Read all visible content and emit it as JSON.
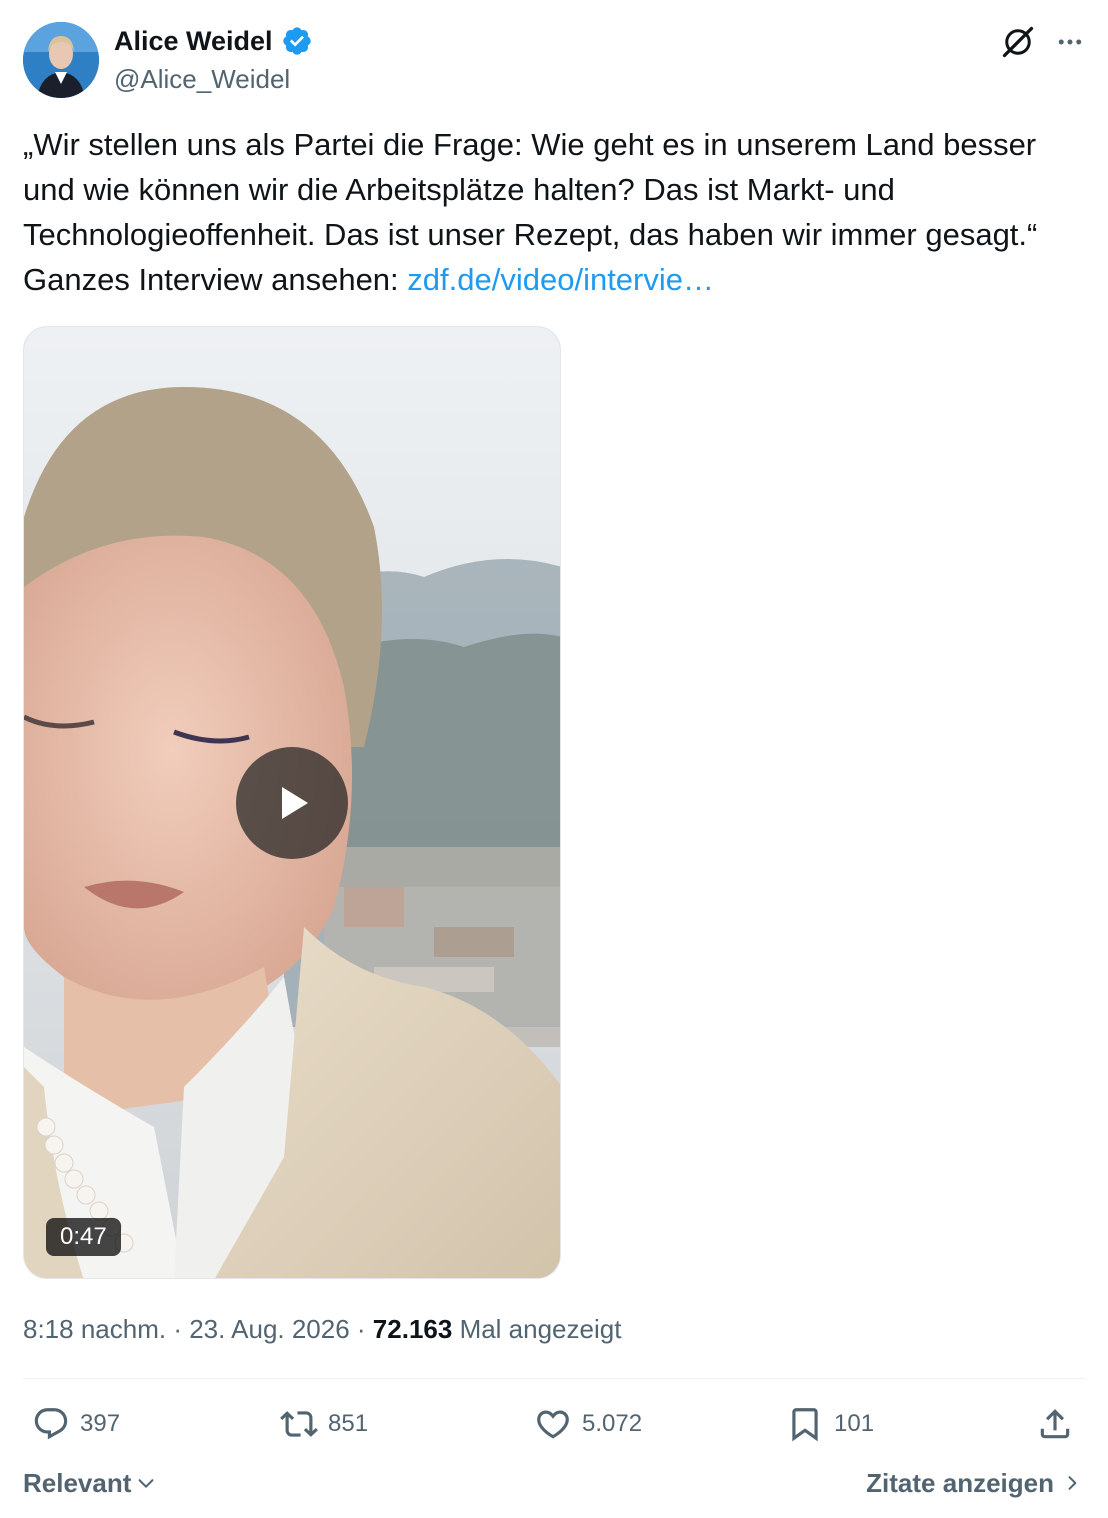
{
  "author": {
    "name": "Alice Weidel",
    "handle": "@Alice_Weidel",
    "verified": true,
    "badge_color": "#1d9bf0"
  },
  "header_icons": [
    "grok-icon",
    "more-icon"
  ],
  "tweet": {
    "text": "„Wir stellen uns als Partei die Frage: Wie geht es in unserem Land besser und wie können wir die Arbeitsplätze halten? Das ist Markt- und Technologieoffenheit. Das ist unser Rezept, das haben wir immer gesagt.“ Ganzes Interview ansehen: ",
    "link": "zdf.de/video/intervie…",
    "link_color": "#1d9bf0"
  },
  "video": {
    "duration": "0:47"
  },
  "meta": {
    "time": "8:18 nachm.",
    "separator": " · ",
    "date": "23. Aug. 2026",
    "views": "72.163",
    "views_label": "Mal angezeigt"
  },
  "actions": {
    "replies": "397",
    "reposts": "851",
    "likes": "5.072",
    "bookmarks": "101"
  },
  "footer": {
    "sort_label": "Relevant",
    "quotes_label": "Zitate anzeigen"
  }
}
